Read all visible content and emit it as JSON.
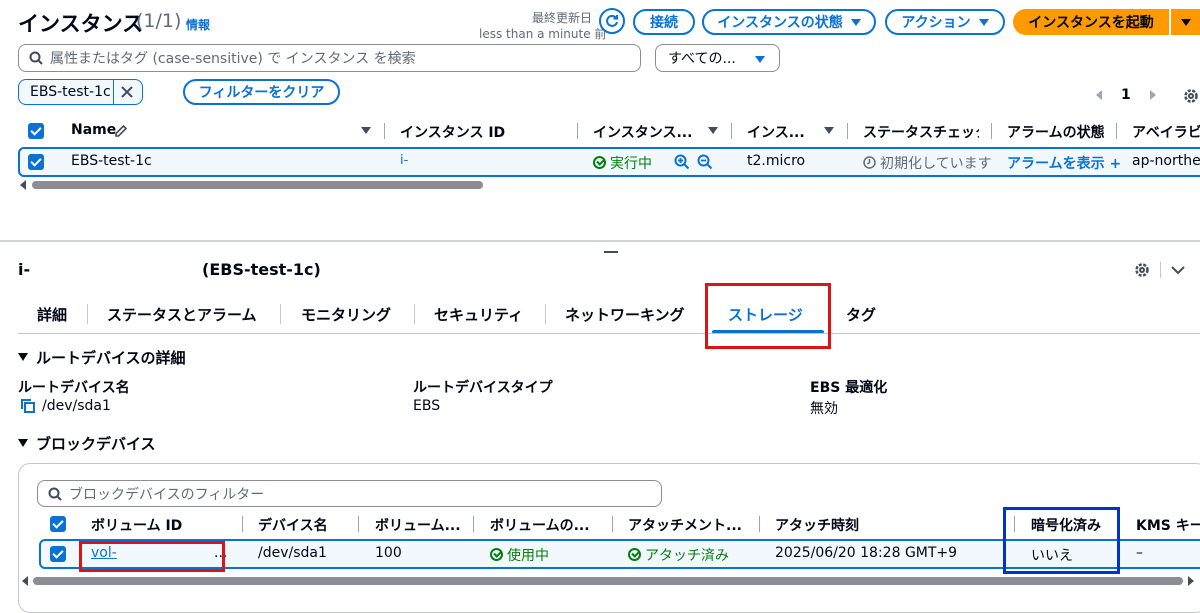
{
  "header": {
    "title": "インスタンス",
    "count": "(1/1)",
    "info_link": "情報",
    "last_updated_label": "最終更新日",
    "last_updated_value": "less than a minute 前",
    "connect_button": "接続",
    "instance_state_button": "インスタンスの状態",
    "actions_button": "アクション",
    "launch_button": "インスタンスを起動"
  },
  "search": {
    "placeholder": "属性またはタグ (case-sensitive) で インスタンス を検索",
    "states_select": "すべての..."
  },
  "filter": {
    "token": "EBS-test-1c",
    "clear_button": "フィルターをクリア"
  },
  "pagination": {
    "page": "1"
  },
  "instances_table": {
    "columns": [
      "Name",
      "インスタンス ID",
      "インスタンス...",
      "インス...",
      "ステータスチェック",
      "アラームの状態",
      "アベイラビ"
    ],
    "row": {
      "name": "EBS-test-1c",
      "instance_id": "i-",
      "state": "実行中",
      "type": "t2.micro",
      "status_check": "初期化しています",
      "alarm": "アラームを表示",
      "alarm_add": "+",
      "az": "ap-northea"
    }
  },
  "detail": {
    "instance_prefix": "i-",
    "instance_name": "(EBS-test-1c)",
    "tabs": [
      "詳細",
      "ステータスとアラーム",
      "モニタリング",
      "セキュリティ",
      "ネットワーキング",
      "ストレージ",
      "タグ"
    ],
    "active_tab": "ストレージ"
  },
  "root_device": {
    "section_title": "ルートデバイスの詳細",
    "name_label": "ルートデバイス名",
    "name_value": "/dev/sda1",
    "type_label": "ルートデバイスタイプ",
    "type_value": "EBS",
    "ebs_opt_label": "EBS 最適化",
    "ebs_opt_value": "無効"
  },
  "block_devices": {
    "section_title": "ブロックデバイス",
    "filter_placeholder": "ブロックデバイスのフィルター",
    "columns": [
      "ボリューム ID",
      "デバイス名",
      "ボリューム...",
      "ボリュームの...",
      "アタッチメント...",
      "アタッチ時刻",
      "暗号化済み",
      "KMS キー"
    ],
    "row": {
      "volume_id": "vol-",
      "ellipsis": "...",
      "device_name": "/dev/sda1",
      "size": "100",
      "volume_state": "使用中",
      "attachment_status": "アタッチ済み",
      "attach_time": "2025/06/20 18:28 GMT+9",
      "encrypted": "いいえ",
      "kms": "–"
    }
  },
  "colors": {
    "accent": "#0972d3",
    "primary_button": "#ff9900",
    "success": "#037f0c",
    "highlight_red": "#d91515",
    "highlight_blue": "#0033cc"
  }
}
